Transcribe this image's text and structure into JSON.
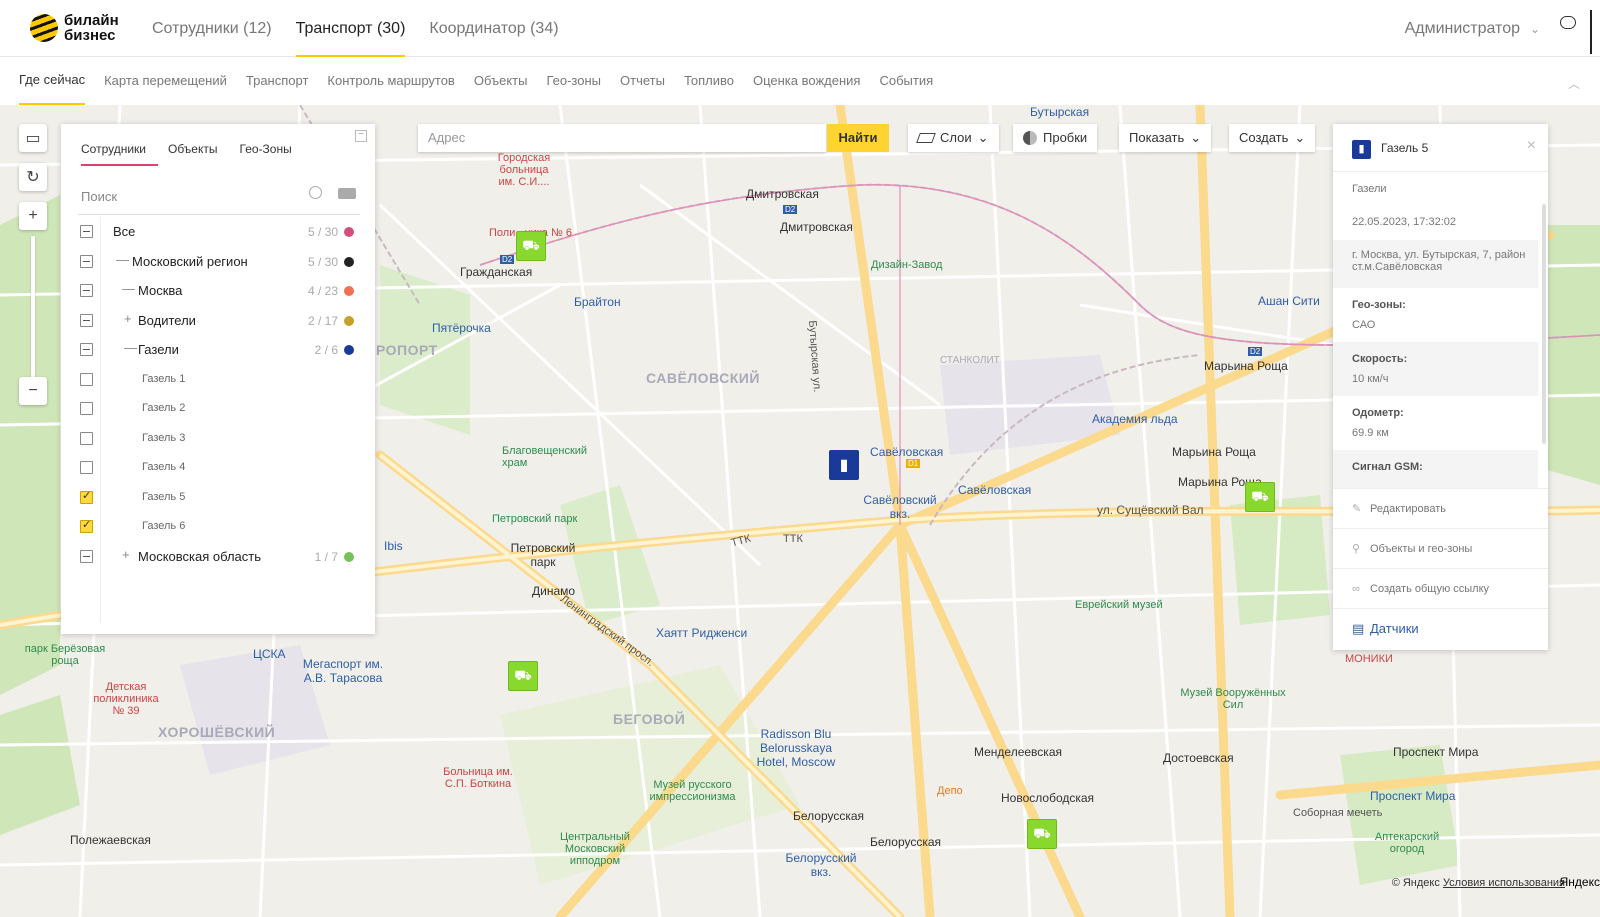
{
  "brand": {
    "line1": "билайн",
    "line2": "бизнес"
  },
  "main_tabs": [
    {
      "label": "Сотрудники (12)"
    },
    {
      "label": "Транспорт (30)"
    },
    {
      "label": "Координатор (34)"
    }
  ],
  "header_user": "Администратор",
  "subnav": [
    {
      "label": "Где сейчас"
    },
    {
      "label": "Карта перемещений"
    },
    {
      "label": "Транспорт"
    },
    {
      "label": "Контроль маршрутов"
    },
    {
      "label": "Объекты"
    },
    {
      "label": "Гео-зоны"
    },
    {
      "label": "Отчеты"
    },
    {
      "label": "Топливо"
    },
    {
      "label": "Оценка вождения"
    },
    {
      "label": "События"
    }
  ],
  "left_panel": {
    "tabs": [
      {
        "label": "Сотрудники"
      },
      {
        "label": "Объекты"
      },
      {
        "label": "Гео-Зоны"
      }
    ],
    "search_placeholder": "Поиск",
    "tree": [
      {
        "label": "Все",
        "count": "5 / 30",
        "color": "#d24f7a",
        "state": "partial",
        "expander": ""
      },
      {
        "label": "Московский регион",
        "count": "5 / 30",
        "color": "#222222",
        "state": "partial",
        "expander": "—"
      },
      {
        "label": "Москва",
        "count": "4 / 23",
        "color": "#f07050",
        "state": "partial",
        "expander": "—"
      },
      {
        "label": "Водители",
        "count": "2 / 17",
        "color": "#c7a22a",
        "state": "partial",
        "expander": "+"
      },
      {
        "label": "Газели",
        "count": "2 / 6",
        "color": "#1a3a9a",
        "state": "partial",
        "expander": "—"
      },
      {
        "label": "Газель 1",
        "count": "",
        "color": "",
        "state": "off",
        "expander": ""
      },
      {
        "label": "Газель 2",
        "count": "",
        "color": "",
        "state": "off",
        "expander": ""
      },
      {
        "label": "Газель 3",
        "count": "",
        "color": "",
        "state": "off",
        "expander": ""
      },
      {
        "label": "Газель 4",
        "count": "",
        "color": "",
        "state": "off",
        "expander": ""
      },
      {
        "label": "Газель 5",
        "count": "",
        "color": "",
        "state": "checked",
        "expander": ""
      },
      {
        "label": "Газель 6",
        "count": "",
        "color": "",
        "state": "checked",
        "expander": ""
      },
      {
        "label": "Московская область",
        "count": "1 / 7",
        "color": "#77c25a",
        "state": "partial",
        "expander": "+"
      }
    ]
  },
  "toolbar": {
    "address_placeholder": "Адрес",
    "find_label": "Найти",
    "layers_label": "Слои",
    "traffic_label": "Пробки",
    "show_label": "Показать",
    "create_label": "Создать"
  },
  "right_panel": {
    "title": "Газель 5",
    "group": "Газели",
    "datetime": "22.05.2023, 17:32:02",
    "address": "г. Москва, ул. Бутырская, 7, район ст.м.Савёловская",
    "geozones_key": "Гео-зоны:",
    "geozones_val": "САО",
    "speed_key": "Скорость:",
    "speed_val": "10 км/ч",
    "odometer_key": "Одометр:",
    "odometer_val": "69.9 км",
    "gsm_key": "Сигнал GSM:",
    "actions": {
      "edit": "Редактировать",
      "objects": "Объекты и гео-зоны",
      "share": "Создать общую ссылку",
      "sensors": "Датчики"
    }
  },
  "map_labels": {
    "savelovsky": "САВЁЛОВСКИЙ",
    "begovoy": "БЕГОВОЙ",
    "khoroshevsky": "ХОРОШЁВСКИЙ",
    "aeroport": "РОПОРТ",
    "stankolit": "СТАНКОЛИТ",
    "dmitrovskaya": "Дмитровская",
    "dmitrovskaya2": "Дмитровская",
    "savelovskaya": "Савёловская",
    "savelovskaya2": "Савёловская",
    "savelovsky_station": "Савёловский вкз.",
    "dinamo": "Динамо",
    "petrovsky_park": "Петровский парк",
    "petrovsky_park2": "Петровский парк",
    "belorusskaya": "Белорусская",
    "belorusskaya2": "Белорусская",
    "belorussky_station": "Белорусский вкз.",
    "mendeleevskaya": "Менделеевская",
    "novoslobodskaya": "Новослободская",
    "dostoevskaya": "Достоевская",
    "maryina_roscha": "Марьина Роща",
    "maryina_roscha2": "Марьина Роща",
    "maryina_roscha3": "Марьина Роща",
    "grazhdanskaya": "Гражданская",
    "prospekt_mira": "Проспект Мира",
    "prospekt_mira2": "Проспект Мира",
    "design_zavod": "Дизайн-Завод",
    "brighton": "Брайтон",
    "pyaterochka": "Пятёрочка",
    "ashan": "Ашан Сити",
    "akademia": "Академия льда",
    "jewish_museum": "Еврейский музей",
    "military_museum": "Музей Вооружённых Сил",
    "hyatt": "Хаятт Ридженси",
    "radisson": "Radisson Blu Belorusskaya Hotel, Moscow",
    "russian_impressionism": "Музей русского импрессионизма",
    "hippodrome": "Центральный Московский ипподром",
    "botkin": "Больница им. С.П. Боткина",
    "hospital6": "Городская больница им. С.И....",
    "hospital6b": "Поли...ника № 6",
    "blagoveshensky": "Благовещенский храм",
    "ibis": "Ibis",
    "tsska": "ЦСКА",
    "megasport": "Мегаспорт им. А.В. Тарасова",
    "berezovaya": "парк Берёзовая роща",
    "polyclinic39": "Детская поликлиника № 39",
    "polezhaevskaya": "Полежаевская",
    "depo": "Депо",
    "sobornaya": "Соборная мечеть",
    "apteka": "Аптекарский огород",
    "ttk": "ТТК",
    "ttk2": "ТТК",
    "suschevsky": "ул. Сущёвский Вал",
    "monitor": "МОНИКИ",
    "butyrskaya": "Бутырская ул.",
    "butyrskaya_top": "Бутырская",
    "leningradsky": "Ленинградский просп.",
    "savelovskaya_d1": "D1",
    "d2a": "D2",
    "d2b": "D2",
    "d2c": "D2"
  },
  "copyright": {
    "text": "© Яндекс",
    "terms": "Условия использования",
    "brand": "Яндекс"
  }
}
